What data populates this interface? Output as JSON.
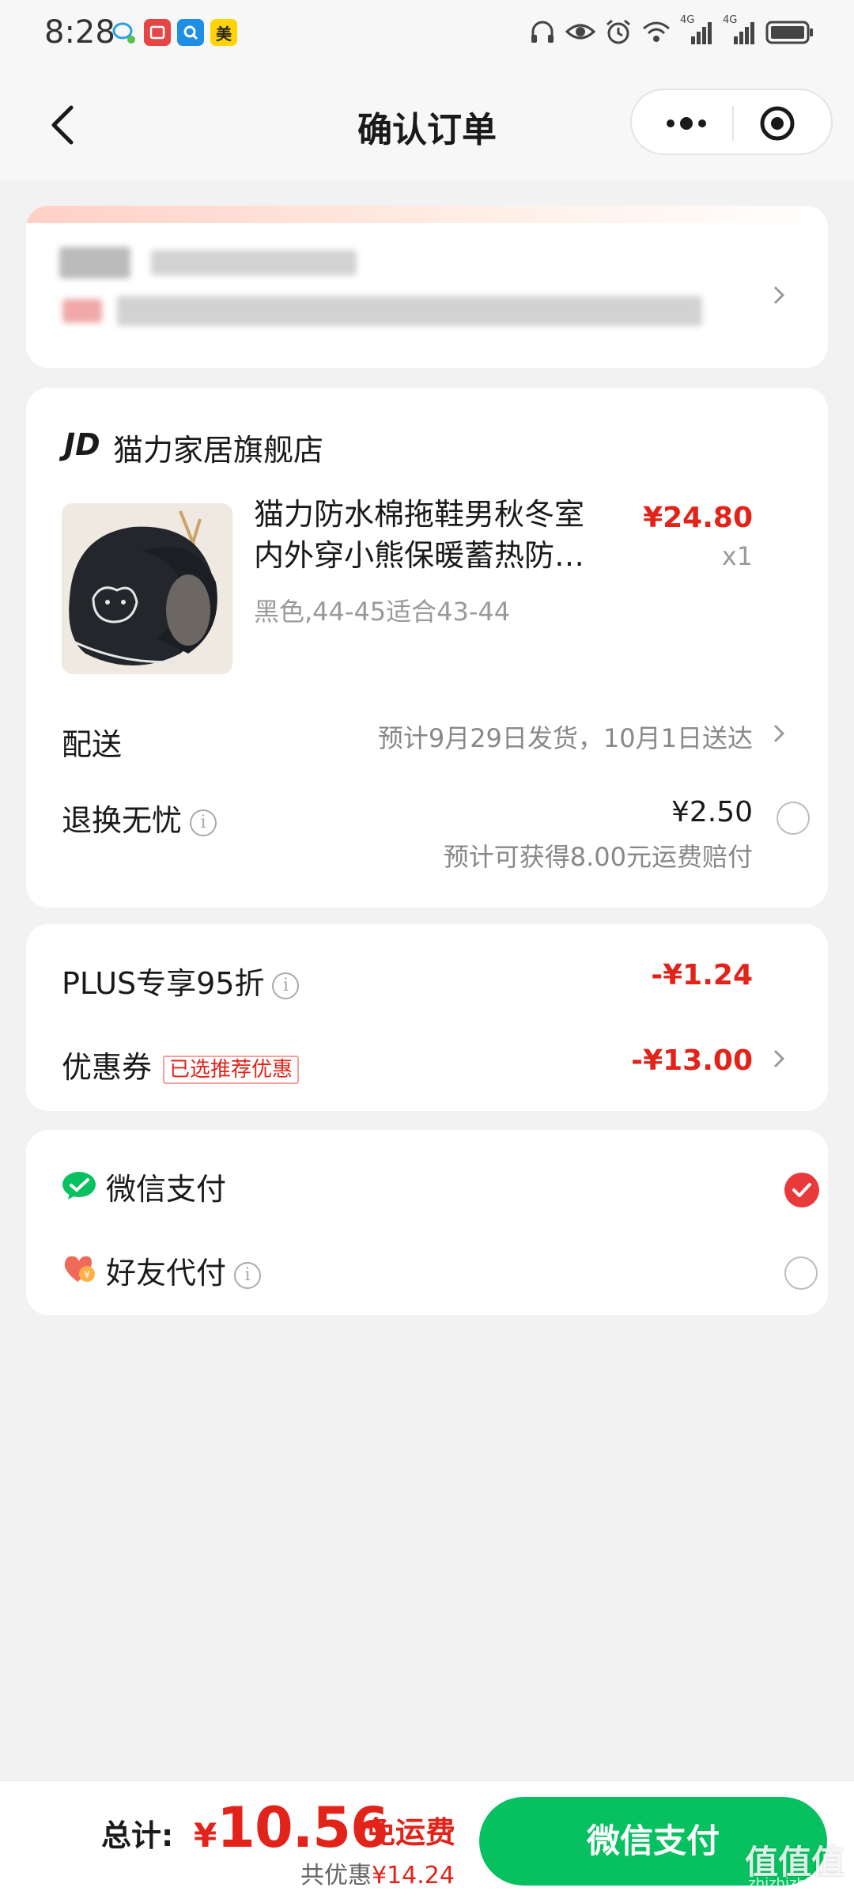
{
  "status_bar": {
    "time": "8:28",
    "apps": [
      {
        "name": "chat-bubble-icon",
        "color": "#ffffff",
        "glyph": ""
      },
      {
        "name": "red-app-icon",
        "color": "#e64545",
        "glyph": ""
      },
      {
        "name": "search-app-icon",
        "color": "#1e8fe6",
        "glyph": ""
      },
      {
        "name": "meituan-app-icon",
        "color": "#ffd400",
        "glyph": "美"
      }
    ],
    "signal_1": "4G",
    "signal_2": "4G"
  },
  "nav": {
    "title": "确认订单"
  },
  "shop": {
    "logo": "JD",
    "name": "猫力家居旗舰店"
  },
  "product": {
    "title_line1": "猫力防水棉拖鞋男秋冬室",
    "title_line2": "内外穿小熊保暖蓄热防…",
    "price": "¥24.80",
    "qty": "x1",
    "spec": "黑色,44-45适合43-44"
  },
  "delivery": {
    "label": "配送",
    "text": "预计9月29日发货，10月1日送达"
  },
  "insurance": {
    "label": "退换无忧",
    "price": "¥2.50",
    "sub": "预计可获得8.00元运费赔付"
  },
  "discounts": {
    "plus_label": "PLUS专享95折",
    "plus_value": "-¥1.24",
    "coupon_label": "优惠券",
    "coupon_tag": "已选推荐优惠",
    "coupon_value": "-¥13.00"
  },
  "payment": {
    "wechat_label": "微信支付",
    "friend_label": "好友代付",
    "selected": "微信支付"
  },
  "footer": {
    "total_label": "总计:",
    "currency": "¥",
    "total": "10.56",
    "free_shipping": "免运费",
    "saved_label": "共优惠",
    "saved": "¥14.24",
    "pay_button": "微信支付"
  },
  "watermark": {
    "text": "值值值",
    "sub": "zhizhizhi.com"
  },
  "colors": {
    "accent_red": "#e2231a",
    "wechat_green": "#07c160"
  }
}
